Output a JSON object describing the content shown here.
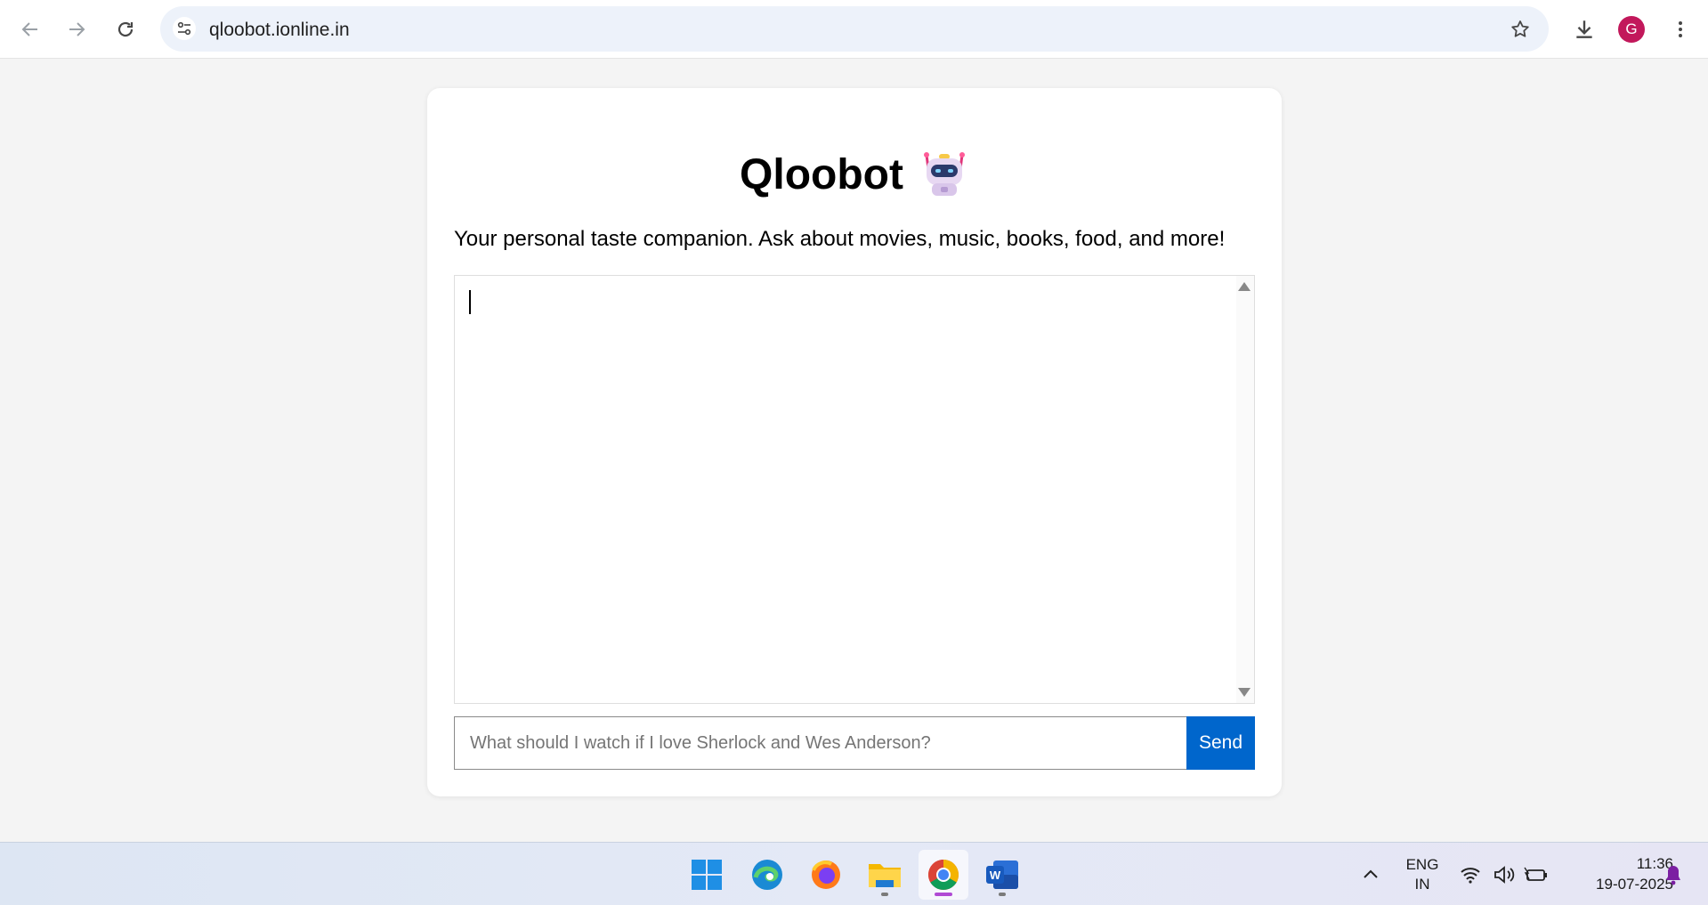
{
  "browser": {
    "url": "qloobot.ionline.in",
    "profile_initial": "G",
    "profile_color": "#c2185b"
  },
  "page": {
    "title": "Qloobot",
    "title_emoji": "robot-emoji",
    "subtitle": "Your personal taste companion. Ask about movies, music, books, food, and more!",
    "chat_input_placeholder": "What should I watch if I love Sherlock and Wes Anderson?",
    "chat_input_value": "",
    "send_label": "Send",
    "accent_color": "#0066cc"
  },
  "taskbar": {
    "apps": [
      "windows-start",
      "edge",
      "firefox",
      "file-explorer",
      "chrome",
      "word"
    ],
    "active_app": "chrome",
    "language_line1": "ENG",
    "language_line2": "IN",
    "time": "11:36",
    "date": "19-07-2025"
  }
}
